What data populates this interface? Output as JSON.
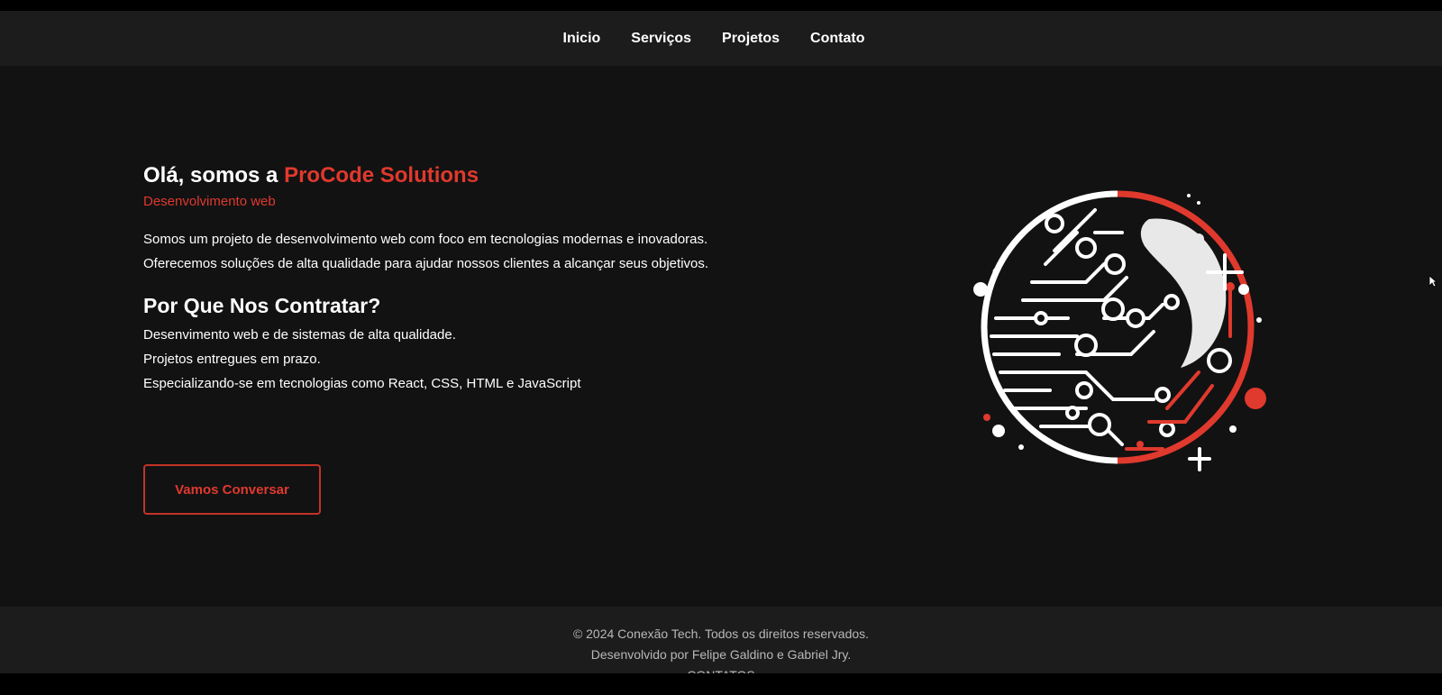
{
  "nav": {
    "items": [
      "Inicio",
      "Serviços",
      "Projetos",
      "Contato"
    ]
  },
  "hero": {
    "greeting": "Olá, somos a",
    "brand": "ProCode Solutions",
    "subtitle": "Desenvolvimento web",
    "description": "Somos um projeto de desenvolvimento web com foco em tecnologias modernas e inovadoras. Oferecemos soluções de alta qualidade para ajudar nossos clientes a alcançar seus objetivos.",
    "why_title": "Por Que Nos Contratar?",
    "why_items": [
      "Desenvimento web e de sistemas de alta qualidade.",
      "Projetos entregues em prazo.",
      "Especializando-se em tecnologias como React, CSS, HTML e JavaScript"
    ],
    "cta_label": "Vamos Conversar"
  },
  "illustration": {
    "icon": "circuit-globe-icon"
  },
  "footer": {
    "copyright": "© 2024 Conexão Tech. Todos os direitos reservados.",
    "credits": "Desenvolvido por Felipe Galdino e Gabriel Jry.",
    "more": "CONTATOS"
  },
  "colors": {
    "accent": "#e0392d",
    "background": "#121213",
    "navbar": "#1c1c1d",
    "footer": "#1c1c1d",
    "text": "#ffffff"
  }
}
